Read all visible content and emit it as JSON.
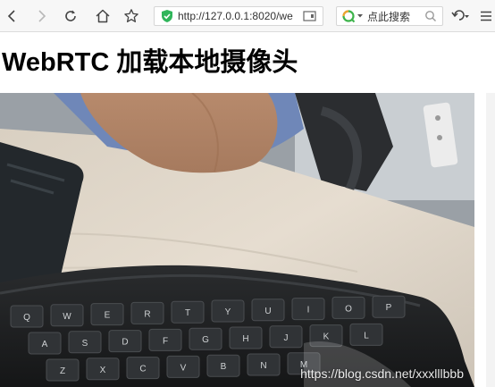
{
  "browser": {
    "url": "http://127.0.0.1:8020/we",
    "search_placeholder": "点此搜索"
  },
  "page": {
    "title": "WebRTC 加载本地摄像头"
  },
  "video": {
    "watermark": "https://blog.csdn.net/xxxlllbbb"
  },
  "keyboard_keys": [
    "Q",
    "W",
    "E",
    "R",
    "T",
    "Y",
    "U",
    "I",
    "O",
    "P",
    "A",
    "S",
    "D",
    "F",
    "G",
    "H",
    "J",
    "K",
    "L",
    "Z",
    "X",
    "C",
    "V",
    "B",
    "N",
    "M"
  ]
}
